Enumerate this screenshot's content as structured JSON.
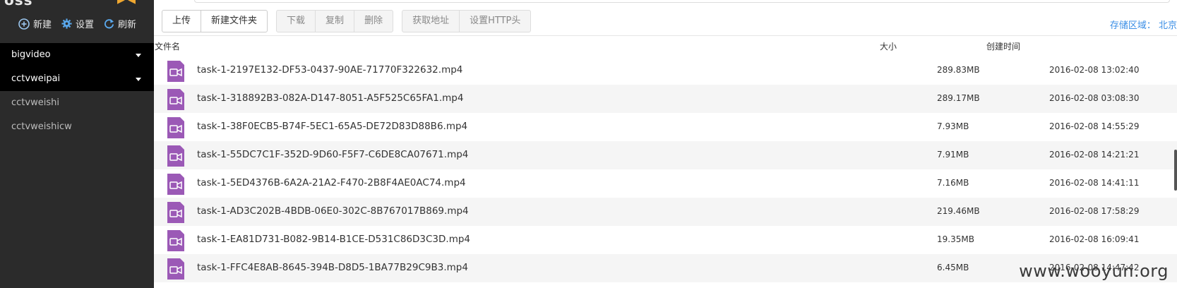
{
  "sidebar": {
    "logo": "oss",
    "actions": {
      "new_label": "新建",
      "settings_label": "设置",
      "refresh_label": "刷新"
    },
    "buckets": [
      {
        "label": "bigvideo",
        "selected": true
      },
      {
        "label": "cctvweipai",
        "selected": true
      },
      {
        "label": "cctvweishi",
        "selected": false
      },
      {
        "label": "cctvweishicw",
        "selected": false
      }
    ]
  },
  "toolbar": {
    "upload_label": "上传",
    "new_folder_label": "新建文件夹",
    "download_label": "下载",
    "copy_label": "复制",
    "delete_label": "删除",
    "get_url_label": "获取地址",
    "set_http_header_label": "设置HTTP头",
    "storage_region_label": "存储区域：",
    "storage_region_value": "北京"
  },
  "table": {
    "headers": {
      "name": "文件名",
      "size": "大小",
      "created": "创建时间"
    },
    "rows": [
      {
        "name": "task-1-2197E132-DF53-0437-90AE-71770F322632.mp4",
        "size": "289.83MB",
        "created": "2016-02-08 13:02:40"
      },
      {
        "name": "task-1-318892B3-082A-D147-8051-A5F525C65FA1.mp4",
        "size": "289.17MB",
        "created": "2016-02-08 03:08:30"
      },
      {
        "name": "task-1-38F0ECB5-B74F-5EC1-65A5-DE72D83D88B6.mp4",
        "size": "7.93MB",
        "created": "2016-02-08 14:55:29"
      },
      {
        "name": "task-1-55DC7C1F-352D-9D60-F5F7-C6DE8CA07671.mp4",
        "size": "7.91MB",
        "created": "2016-02-08 14:21:21"
      },
      {
        "name": "task-1-5ED4376B-6A2A-21A2-F470-2B8F4AE0AC74.mp4",
        "size": "7.16MB",
        "created": "2016-02-08 14:41:11"
      },
      {
        "name": "task-1-AD3C202B-4BDB-06E0-302C-8B767017B869.mp4",
        "size": "219.46MB",
        "created": "2016-02-08 17:58:29"
      },
      {
        "name": "task-1-EA81D731-B082-9B14-B1CE-D531C86D3C3D.mp4",
        "size": "19.35MB",
        "created": "2016-02-08 16:09:41"
      },
      {
        "name": "task-1-FFC4E8AB-8645-394B-D8D5-1BA77B29C9B3.mp4",
        "size": "6.45MB",
        "created": "2016-02-08 14:47:42"
      }
    ]
  },
  "watermark": "www.wooyun.org",
  "colors": {
    "sidebar_bg": "#2b2b2b",
    "selected_bg": "#000000",
    "accent": "#3a8ee6",
    "video_icon": "#9b59b6"
  },
  "icons": {
    "new": "plus-circle-icon",
    "settings": "gear-icon",
    "refresh": "refresh-icon",
    "file": "video-file-icon"
  }
}
